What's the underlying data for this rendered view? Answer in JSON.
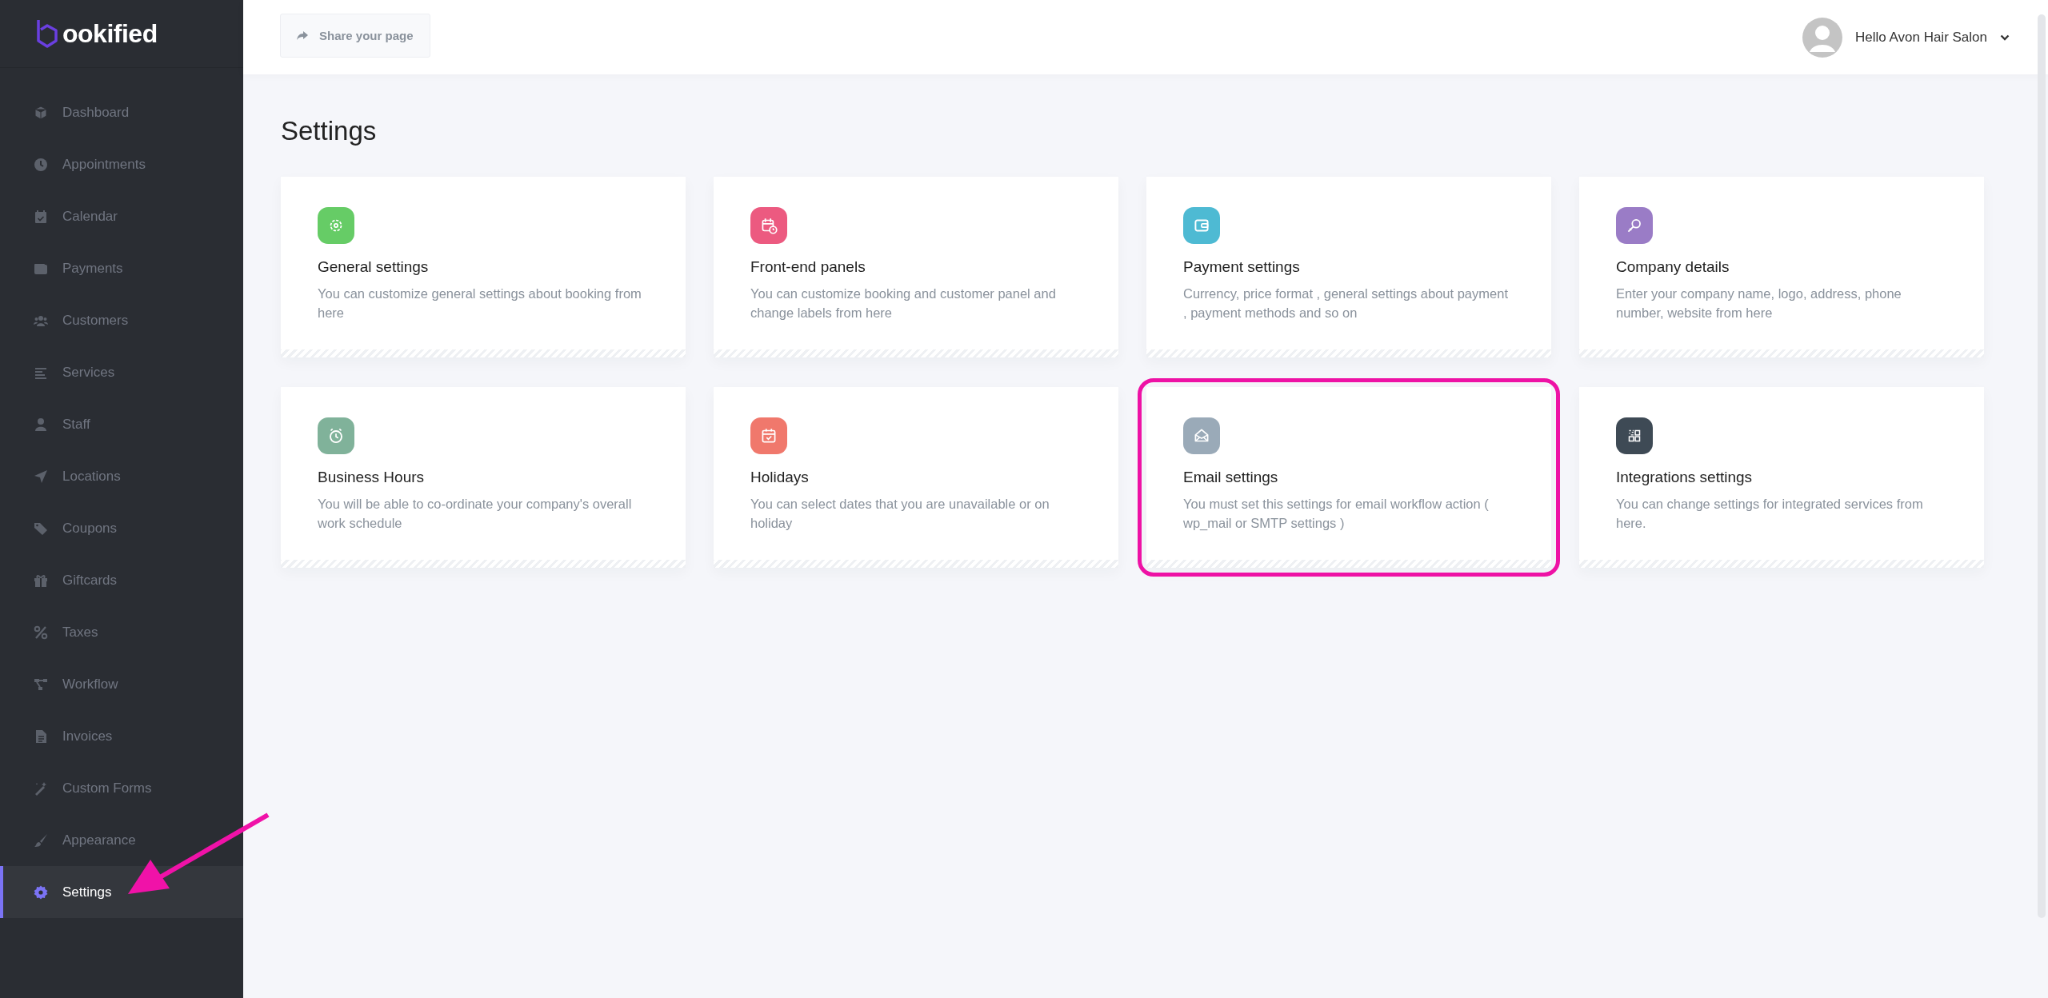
{
  "logo": {
    "text": "ookified"
  },
  "sidebar": {
    "items": [
      {
        "label": "Dashboard",
        "selected": false
      },
      {
        "label": "Appointments",
        "selected": false
      },
      {
        "label": "Calendar",
        "selected": false
      },
      {
        "label": "Payments",
        "selected": false
      },
      {
        "label": "Customers",
        "selected": false
      },
      {
        "label": "Services",
        "selected": false
      },
      {
        "label": "Staff",
        "selected": false
      },
      {
        "label": "Locations",
        "selected": false
      },
      {
        "label": "Coupons",
        "selected": false
      },
      {
        "label": "Giftcards",
        "selected": false
      },
      {
        "label": "Taxes",
        "selected": false
      },
      {
        "label": "Workflow",
        "selected": false
      },
      {
        "label": "Invoices",
        "selected": false
      },
      {
        "label": "Custom Forms",
        "selected": false
      },
      {
        "label": "Appearance",
        "selected": false
      },
      {
        "label": "Settings",
        "selected": true
      }
    ]
  },
  "topbar": {
    "share_button": "Share your page",
    "user": "Hello Avon Hair Salon"
  },
  "page_title": "Settings",
  "cards": [
    {
      "title": "General settings",
      "description": "You can customize general settings about booking from here",
      "color": "#66cc66",
      "highlighted": false
    },
    {
      "title": "Front-end panels",
      "description": "You can customize booking and customer panel and change labels from here",
      "color": "#ec5a80",
      "highlighted": false
    },
    {
      "title": "Payment settings",
      "description": "Currency, price format , general settings about payment , payment methods and so on",
      "color": "#4ebad3",
      "highlighted": false
    },
    {
      "title": "Company details",
      "description": "Enter your company name, logo, address, phone number, website from here",
      "color": "#9a7cc6",
      "highlighted": false
    },
    {
      "title": "Business Hours",
      "description": "You will be able to co-ordinate your company's overall work schedule",
      "color": "#80b29a",
      "highlighted": false
    },
    {
      "title": "Holidays",
      "description": "You can select dates that you are unavailable or on holiday",
      "color": "#f0786c",
      "highlighted": false
    },
    {
      "title": "Email settings",
      "description": "You must set this settings for email workflow action ( wp_mail or SMTP settings )",
      "color": "#9aaab8",
      "highlighted": true
    },
    {
      "title": "Integrations settings",
      "description": "You can change settings for integrated services from here.",
      "color": "#3e4a55",
      "highlighted": false
    }
  ]
}
